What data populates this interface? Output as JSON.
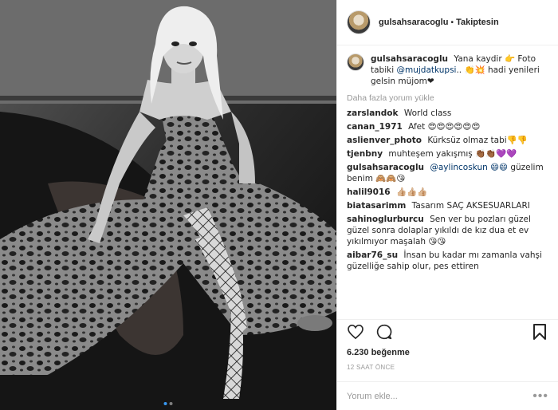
{
  "post": {
    "username": "gulsahsaracoglu",
    "separator": "•",
    "follow_status": "Takiptesin"
  },
  "caption": {
    "username": "gulsahsaracoglu",
    "text_before": "Yana kaydir 👉 Foto tabiki",
    "mention": "@mujdatkupsi",
    "text_after": ".. 👏💥 hadi yenileri gelsin müjom❤"
  },
  "load_more": "Daha fazla yorum yükle",
  "comments": [
    {
      "username": "zarslandok",
      "text": "World class",
      "mention": ""
    },
    {
      "username": "canan_1971",
      "text": "Afet 😍😍😍😍😍😍",
      "mention": ""
    },
    {
      "username": "aslienver_photo",
      "text": "Kürksüz olmaz tabi👎👎",
      "mention": ""
    },
    {
      "username": "tjenbny",
      "text": "muhteşem yakışmış 👏🏾👏🏾💜💜",
      "mention": ""
    },
    {
      "username": "gulsahsaracoglu",
      "text": "güzelim benim 🙈🙈😘",
      "mention": "@aylincoskun 😄😄"
    },
    {
      "username": "halil9016",
      "text": "👍🏼👍🏼👍🏼",
      "mention": ""
    },
    {
      "username": "biatasarimm",
      "text": "Tasarım SAÇ AKSESUARLARI",
      "mention": ""
    },
    {
      "username": "sahinoglurburcu",
      "text": "Sen ver bu pozları güzel güzel sonra dolaplar yıkıldı de kız dua et ev yıkılmıyor maşalah 😘😘",
      "mention": ""
    },
    {
      "username": "aibar76_su",
      "text": "İnsan bu kadar mı zamanla vahşi güzelliğe sahip olur, pes ettiren",
      "mention": ""
    }
  ],
  "icons": {
    "like": "heart-icon",
    "comment": "comment-icon",
    "save": "bookmark-icon",
    "more": "more-options-icon"
  },
  "likes_text": "6.230 beğenme",
  "timestamp": "12 SAAT ÖNCE",
  "add_comment_placeholder": "Yorum ekle...",
  "more_options": "•••",
  "carousel": {
    "count": 2,
    "active": 1
  }
}
